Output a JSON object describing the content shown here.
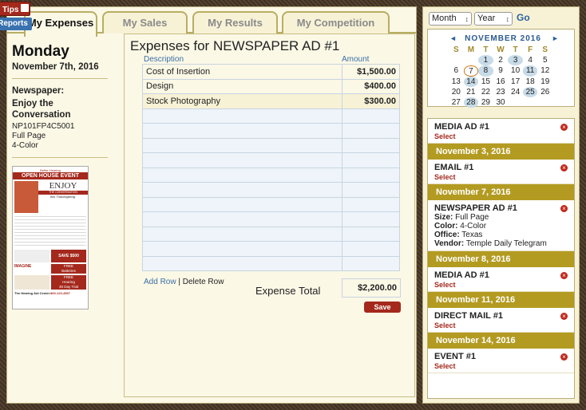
{
  "tabs": {
    "expenses": "My Expenses",
    "sales": "My Sales",
    "results": "My Results",
    "competition": "My Competition"
  },
  "buttons": {
    "tips": "Tips",
    "reports": "Reports",
    "save": "Save",
    "add_row": "Add Row",
    "delete_row": "Delete Row",
    "separator": "|",
    "go": "Go"
  },
  "info": {
    "day": "Monday",
    "date": "November 7th, 2016",
    "media_label": "Newspaper:",
    "ad_name": "Enjoy the Conversation",
    "code": "NP101FP4C5001",
    "size": "Full Page",
    "color": "4-Color"
  },
  "ad_image": {
    "headline": "OPEN HOUSE EVENT",
    "subhead": "Better Hearing",
    "enjoy": "ENJOY",
    "the_conversation": "THE CONVERSATION",
    "thanks": "this Thanksgiving.",
    "save": "SAVE $500",
    "free1": "FREE",
    "batteries": "Batteries",
    "free2": "FREE",
    "hearing": "Hearing",
    "day_trial": "30 Day Trial",
    "imagine": "IMAGINE",
    "center": "The Hearing Aid Center",
    "phone": "800-123-4567"
  },
  "form": {
    "title": "Expenses for NEWSPAPER AD #1",
    "col_description": "Description",
    "col_amount": "Amount",
    "rows": [
      {
        "desc": "Cost of Insertion",
        "amount": "$1,500.00"
      },
      {
        "desc": "Design",
        "amount": "$400.00"
      },
      {
        "desc": "Stock Photography",
        "amount": "$300.00"
      }
    ],
    "blank_rows": 11,
    "total_label": "Expense Total",
    "total_value": "$2,200.00"
  },
  "filters": {
    "month": "Month",
    "year": "Year"
  },
  "calendar": {
    "title": "NOVEMBER 2016",
    "prev": "◄",
    "next": "►",
    "days": [
      "S",
      "M",
      "T",
      "W",
      "T",
      "F",
      "S"
    ],
    "weeks": [
      [
        "",
        "",
        "1",
        "2",
        "3",
        "4",
        "5"
      ],
      [
        "6",
        "7",
        "8",
        "9",
        "10",
        "11",
        "12"
      ],
      [
        "13",
        "14",
        "15",
        "16",
        "17",
        "18",
        "19"
      ],
      [
        "20",
        "21",
        "22",
        "23",
        "24",
        "25",
        "26"
      ],
      [
        "27",
        "28",
        "29",
        "30",
        "",
        "",
        ""
      ]
    ],
    "event_days": [
      "1",
      "3",
      "8",
      "11",
      "14",
      "25",
      "28"
    ],
    "today": "7"
  },
  "events": [
    {
      "type": "item",
      "title": "MEDIA AD #1",
      "select": "Select"
    },
    {
      "type": "head",
      "date": "November 3, 2016"
    },
    {
      "type": "item",
      "title": "EMAIL #1",
      "select": "Select"
    },
    {
      "type": "head",
      "date": "November 7, 2016"
    },
    {
      "type": "detail",
      "title": "NEWSPAPER AD #1",
      "size_label": "Size:",
      "size": "Full Page",
      "color_label": "Color:",
      "color": "4-Color",
      "office_label": "Office:",
      "office": "Texas",
      "vendor_label": "Vendor:",
      "vendor": "Temple Daily Telegram"
    },
    {
      "type": "head",
      "date": "November 8, 2016"
    },
    {
      "type": "item",
      "title": "MEDIA AD #1",
      "select": "Select"
    },
    {
      "type": "head",
      "date": "November 11, 2016"
    },
    {
      "type": "item",
      "title": "DIRECT MAIL #1",
      "select": "Select"
    },
    {
      "type": "head",
      "date": "November 14, 2016"
    },
    {
      "type": "item",
      "title": "EVENT #1",
      "select": "Select"
    }
  ],
  "colors": {
    "accent_gold": "#b39b22",
    "button_red": "#a4281c",
    "link_blue": "#3b6ea5"
  }
}
